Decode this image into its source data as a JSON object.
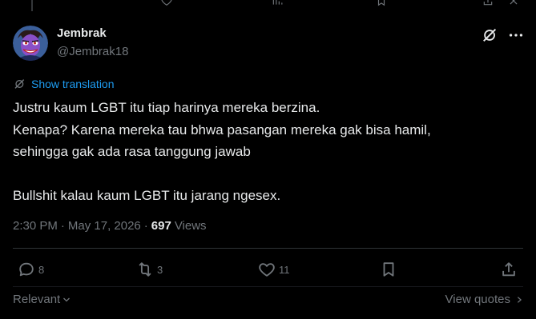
{
  "post": {
    "author_name": "Jembrak",
    "author_handle": "@Jembrak18",
    "translate_label": "Show translation",
    "text_lines": [
      "Justru kaum LGBT itu tiap harinya mereka berzina.",
      "Kenapa? Karena mereka tau bhwa pasangan mereka gak bisa hamil,",
      "sehingga gak ada rasa tanggung jawab",
      "",
      "Bullshit kalau kaum LGBT itu jarang ngesex."
    ],
    "time": "2:30 PM",
    "date": "May 17, 2026",
    "separator": "·",
    "views_count": "697",
    "views_label": "Views"
  },
  "actions": {
    "replies": "8",
    "reposts": "3",
    "likes": "11"
  },
  "footer": {
    "sort_label": "Relevant",
    "view_quotes_label": "View quotes"
  },
  "colors": {
    "background": "#000000",
    "text": "#e7e9ea",
    "muted": "#71767b",
    "link": "#1d9bf0",
    "divider": "#2f3336"
  },
  "icons": {
    "top": [
      "reply-icon",
      "repost-icon",
      "like-icon",
      "bookmark-icon",
      "share-icon"
    ],
    "header": [
      "grok-icon",
      "more-icon"
    ],
    "actions": [
      "reply-icon",
      "repost-icon",
      "like-icon",
      "bookmark-icon",
      "share-icon"
    ]
  }
}
